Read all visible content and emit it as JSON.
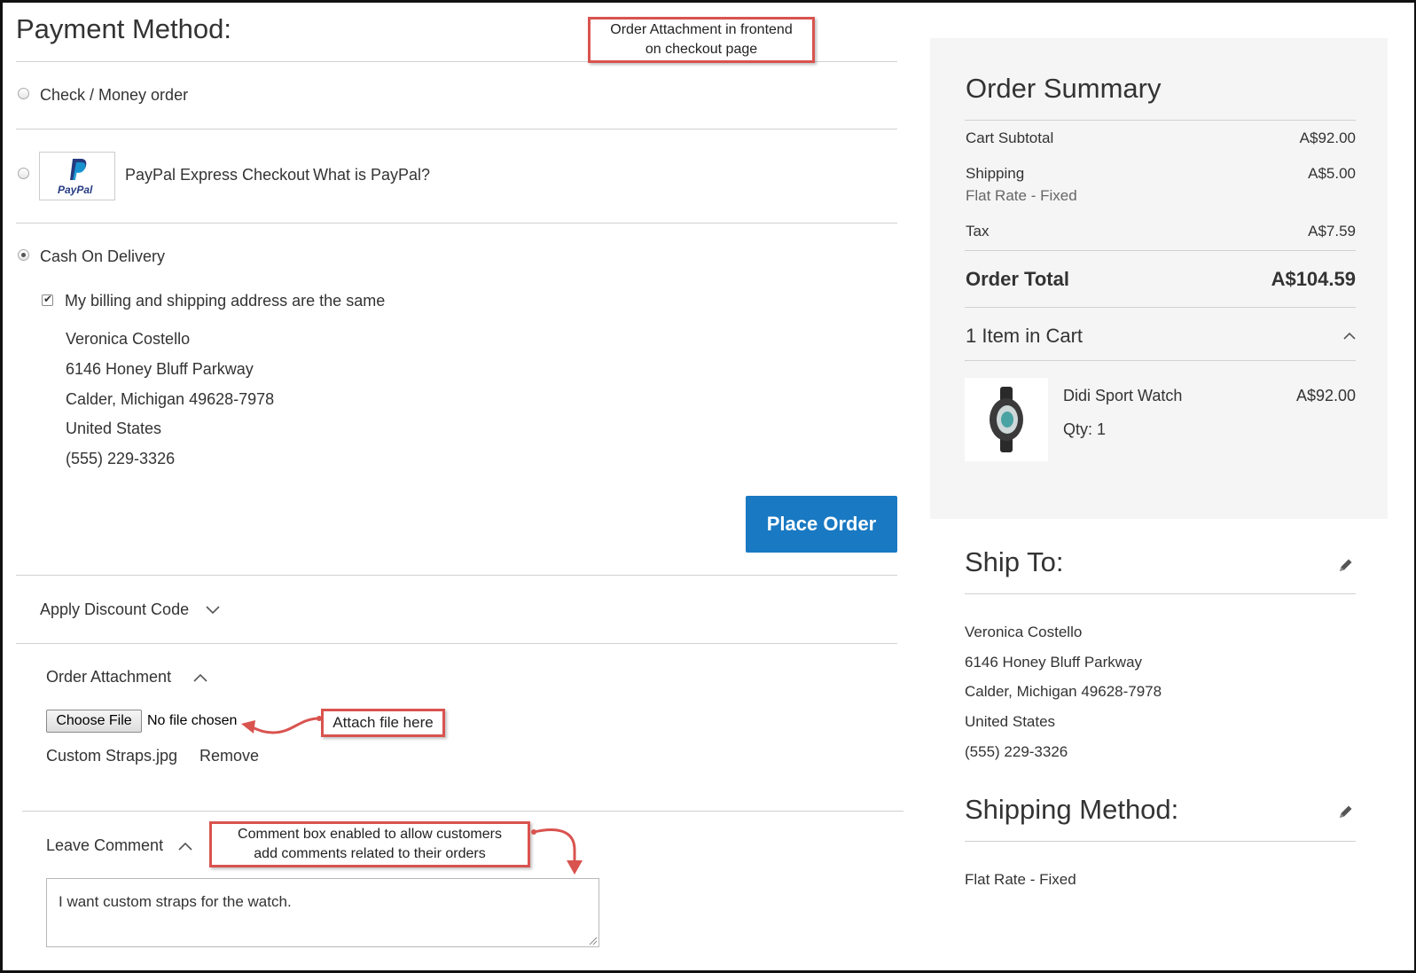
{
  "payment": {
    "title": "Payment Method:",
    "options": {
      "check": "Check / Money order",
      "paypal": "PayPal Express Checkout",
      "paypal_link": "What is PayPal?",
      "paypal_logo": "PayPal",
      "cod": "Cash On Delivery"
    },
    "same_address_label": "My billing and shipping address are the same",
    "address": {
      "name": "Veronica Costello",
      "street": "6146 Honey Bluff Parkway",
      "city": "Calder, Michigan 49628-7978",
      "country": "United States",
      "phone": "(555) 229-3326"
    },
    "place_order": "Place Order"
  },
  "discount": {
    "label": "Apply Discount Code"
  },
  "attachment": {
    "label": "Order Attachment",
    "choose_file": "Choose File",
    "no_file": "No file chosen",
    "file_name": "Custom Straps.jpg",
    "remove": "Remove"
  },
  "comment": {
    "label": "Leave Comment",
    "value": "I want custom straps for the watch."
  },
  "callouts": {
    "top_line1": "Order Attachment in frontend",
    "top_line2": "on checkout page",
    "attach": "Attach file here",
    "comment_line1": "Comment box enabled to allow customers",
    "comment_line2": "add comments related to their orders"
  },
  "summary": {
    "title": "Order Summary",
    "cart_subtotal_label": "Cart Subtotal",
    "cart_subtotal_value": "A$92.00",
    "shipping_label": "Shipping",
    "shipping_method": "Flat Rate - Fixed",
    "shipping_value": "A$5.00",
    "tax_label": "Tax",
    "tax_value": "A$7.59",
    "total_label": "Order Total",
    "total_value": "A$104.59",
    "items_label": "1 Item in Cart",
    "item": {
      "name": "Didi Sport Watch",
      "qty": "Qty: 1",
      "price": "A$92.00"
    }
  },
  "ship_to": {
    "title": "Ship To:",
    "name": "Veronica Costello",
    "street": "6146 Honey Bluff Parkway",
    "city": "Calder, Michigan 49628-7978",
    "country": "United States",
    "phone": "(555) 229-3326"
  },
  "shipping_method": {
    "title": "Shipping Method:",
    "value": "Flat Rate - Fixed"
  },
  "colors": {
    "link": "#1979c3",
    "primary_button": "#1979c3",
    "callout_border": "#d9534f",
    "sidebar_bg": "#f5f5f5"
  }
}
